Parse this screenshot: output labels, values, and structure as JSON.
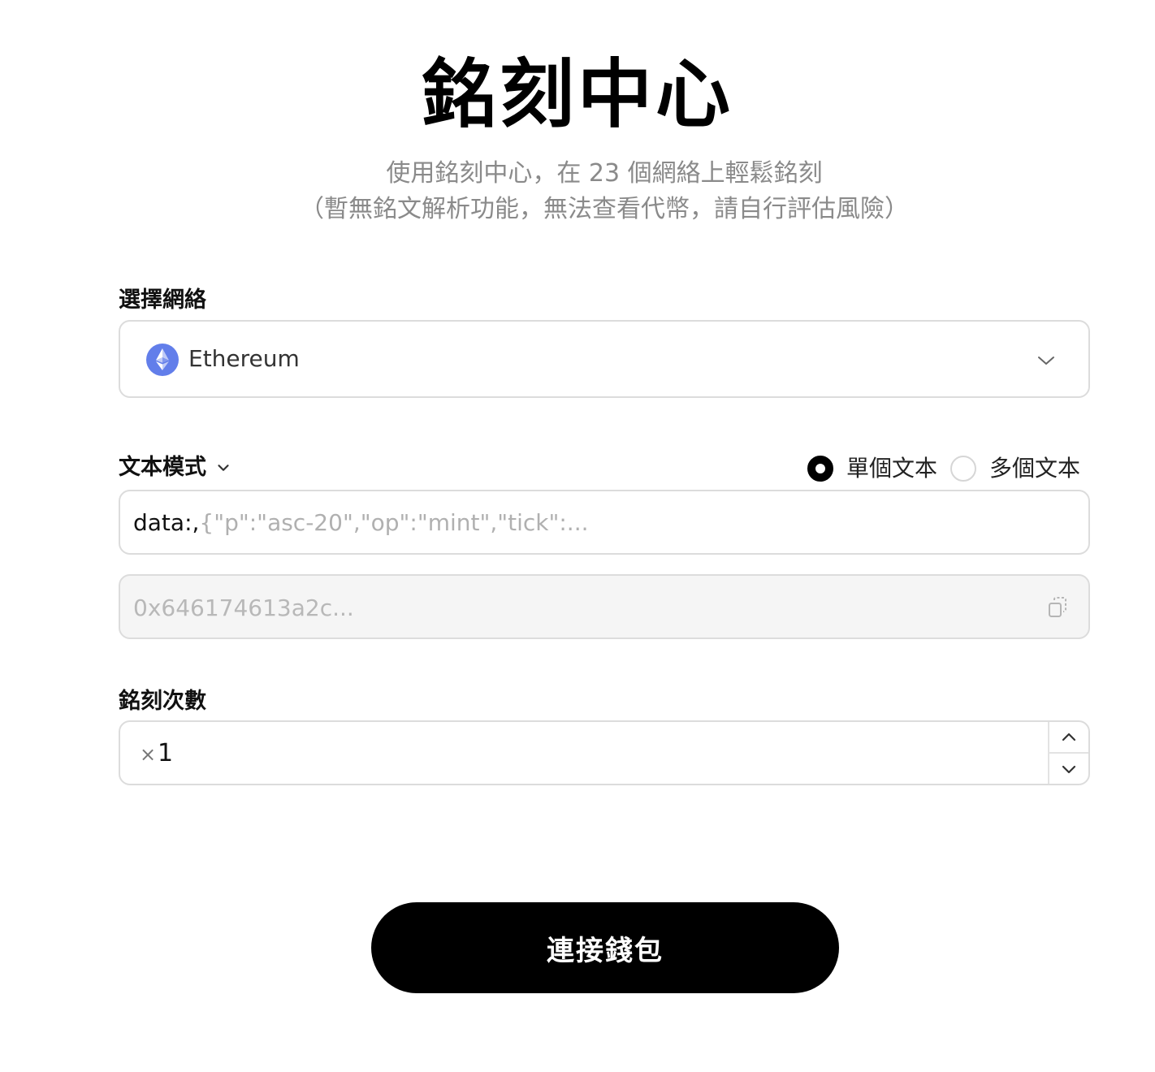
{
  "header": {
    "title": "銘刻中心",
    "subtitle_line1": "使用銘刻中心，在 23 個網絡上輕鬆銘刻",
    "subtitle_line2": "（暫無銘文解析功能，無法查看代幣，請自行評估風險）"
  },
  "network": {
    "label": "選擇網絡",
    "selected": "Ethereum",
    "icon": "ethereum-icon",
    "icon_color": "#627eea"
  },
  "mode": {
    "label": "文本模式",
    "options": [
      {
        "label": "單個文本",
        "checked": true
      },
      {
        "label": "多個文本",
        "checked": false
      }
    ]
  },
  "data_input": {
    "prefix": "data:,",
    "placeholder": "{\"p\":\"asc-20\",\"op\":\"mint\",\"tick\":..."
  },
  "hex_output": {
    "placeholder": "0x646174613a2c..."
  },
  "count": {
    "label": "銘刻次數",
    "prefix": "×",
    "value": "1"
  },
  "actions": {
    "connect_label": "連接錢包"
  },
  "colors": {
    "accent": "#000000",
    "muted_text": "#8a8a8a",
    "border": "#dcdcdc",
    "readonly_bg": "#f5f5f5"
  }
}
